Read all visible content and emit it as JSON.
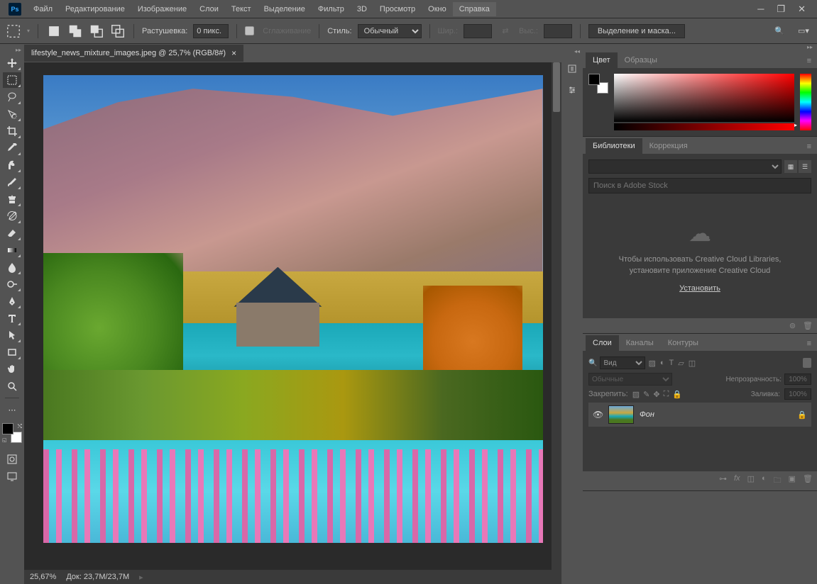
{
  "menu": {
    "items": [
      "Файл",
      "Редактирование",
      "Изображение",
      "Слои",
      "Текст",
      "Выделение",
      "Фильтр",
      "3D",
      "Просмотр",
      "Окно",
      "Справка"
    ],
    "active": 10
  },
  "options": {
    "feather_label": "Растушевка:",
    "feather_value": "0 пикс.",
    "antialias_label": "Сглаживание",
    "style_label": "Стиль:",
    "style_value": "Обычный",
    "width_label": "Шир.:",
    "height_label": "Выс.:",
    "select_mask": "Выделение и маска..."
  },
  "document": {
    "tab_title": "lifestyle_news_mixture_images.jpeg @ 25,7% (RGB/8#)",
    "zoom": "25,67%",
    "doc_info": "Док: 23,7M/23,7M"
  },
  "panels": {
    "color": {
      "tabs": [
        "Цвет",
        "Образцы"
      ],
      "active": 0
    },
    "libraries": {
      "tabs": [
        "Библиотеки",
        "Коррекция"
      ],
      "active": 0,
      "search_placeholder": "Поиск в Adobe Stock",
      "msg_line1": "Чтобы использовать Creative Cloud Libraries,",
      "msg_line2": "установите приложение Creative Cloud",
      "install": "Установить"
    },
    "layers": {
      "tabs": [
        "Слои",
        "Каналы",
        "Контуры"
      ],
      "active": 0,
      "filter_kind": "Вид",
      "blend_mode": "Обычные",
      "opacity_label": "Непрозрачность:",
      "opacity_value": "100%",
      "lock_label": "Закрепить:",
      "fill_label": "Заливка:",
      "fill_value": "100%",
      "layer_name": "Фон"
    }
  }
}
